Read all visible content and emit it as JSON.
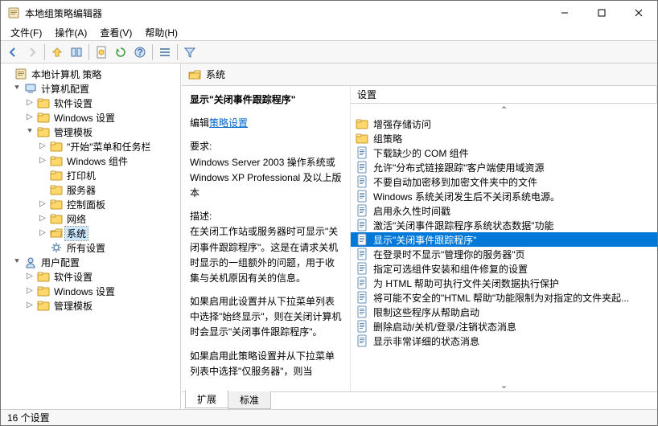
{
  "window": {
    "title": "本地组策略编辑器"
  },
  "menu": {
    "file": "文件(F)",
    "action": "操作(A)",
    "view": "查看(V)",
    "help": "帮助(H)"
  },
  "tree": {
    "root": "本地计算机 策略",
    "computer": "计算机配置",
    "c_software": "软件设置",
    "c_windows": "Windows 设置",
    "c_admin": "管理模板",
    "c_admin_start": "\"开始\"菜单和任务栏",
    "c_admin_wincomp": "Windows 组件",
    "c_admin_printer": "打印机",
    "c_admin_server": "服务器",
    "c_admin_cp": "控制面板",
    "c_admin_network": "网络",
    "c_admin_system": "系统",
    "c_admin_all": "所有设置",
    "user": "用户配置",
    "u_software": "软件设置",
    "u_windows": "Windows 设置",
    "u_admin": "管理模板"
  },
  "header": {
    "title": "系统"
  },
  "desc": {
    "title": "显示\"关闭事件跟踪程序\"",
    "edit_prefix": "编辑",
    "edit_link": "策略设置",
    "req_label": "要求:",
    "req_text": "Windows Server 2003 操作系统或 Windows XP Professional 及以上版本",
    "desc_label": "描述:",
    "p1": "在关闭工作站或服务器时可显示\"关闭事件跟踪程序\"。这是在请求关机时显示的一组额外的问题，用于收集与关机原因有关的信息。",
    "p2": "如果启用此设置并从下拉菜单列表中选择\"始终显示\"，则在关闭计算机时会显示\"关闭事件跟踪程序\"。",
    "p3": "如果启用此策略设置并从下拉菜单列表中选择\"仅服务器\"，则当"
  },
  "list": {
    "col": "设置",
    "items": [
      "增强存储访问",
      "组策略",
      "下载缺少的 COM 组件",
      "允许\"分布式链接跟踪\"客户端使用域资源",
      "不要自动加密移到加密文件夹中的文件",
      "Windows 系统关闭发生后不关闭系统电源。",
      "启用永久性时间戳",
      "激活\"关闭事件跟踪程序系统状态数据\"功能",
      "显示\"关闭事件跟踪程序\"",
      "在登录时不显示\"管理你的服务器\"页",
      "指定可选组件安装和组件修复的设置",
      "为 HTML 帮助可执行文件关闭数据执行保护",
      "将可能不安全的\"HTML 帮助\"功能限制为对指定的文件夹起...",
      "限制这些程序从帮助启动",
      "删除启动/关机/登录/注销状态消息",
      "显示非常详细的状态消息"
    ],
    "types": [
      "folder",
      "folder",
      "policy",
      "policy",
      "policy",
      "policy",
      "policy",
      "policy",
      "policy",
      "policy",
      "policy",
      "policy",
      "policy",
      "policy",
      "policy",
      "policy"
    ],
    "selected": 8
  },
  "tabs": {
    "extended": "扩展",
    "standard": "标准"
  },
  "status": {
    "text": "16 个设置"
  }
}
